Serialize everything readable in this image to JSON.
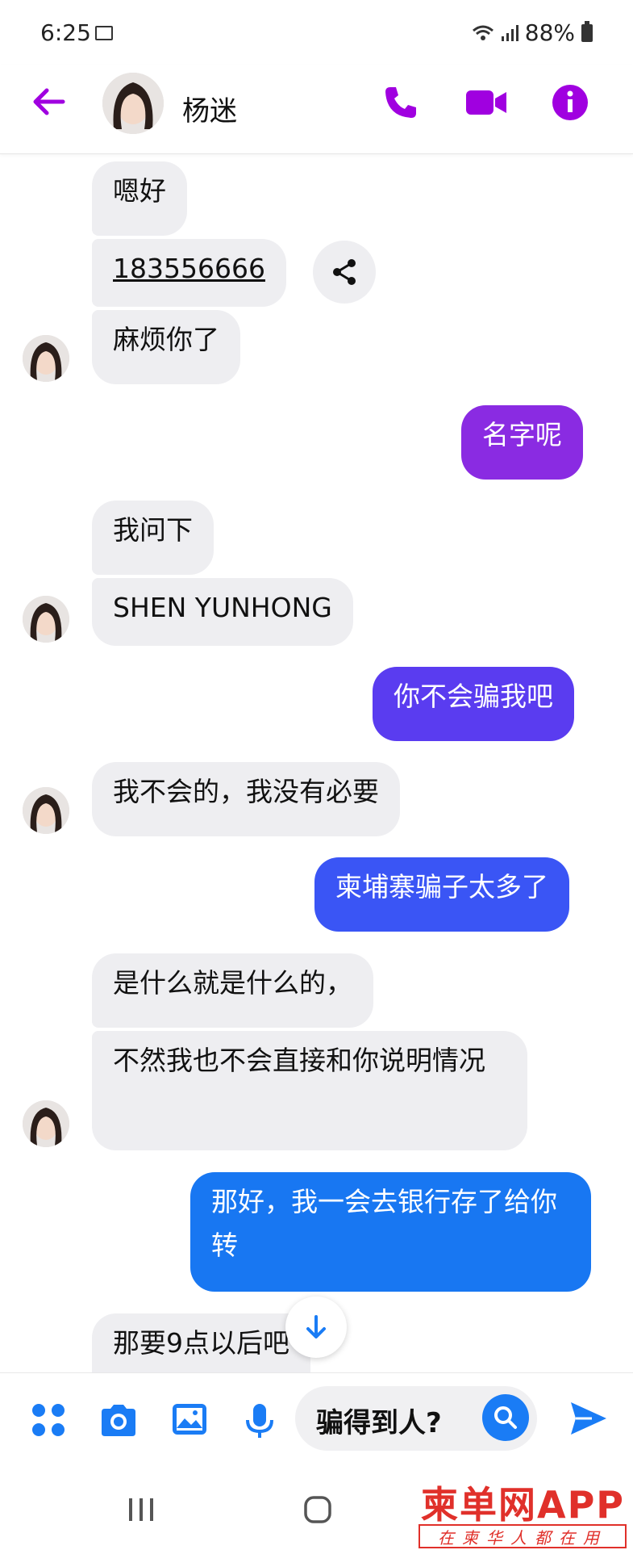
{
  "status_bar": {
    "time": "6:25",
    "battery": "88%"
  },
  "header": {
    "contact_name": "杨迷"
  },
  "messages": [
    {
      "text": "嗯好"
    },
    {
      "text": "183556666"
    },
    {
      "text": "麻烦你了"
    },
    {
      "text": "名字呢"
    },
    {
      "text": "我问下"
    },
    {
      "text": "SHEN YUNHONG"
    },
    {
      "text": "你不会骗我吧"
    },
    {
      "text": "我不会的，我没有必要"
    },
    {
      "text": "柬埔寨骗子太多了"
    },
    {
      "text": "是什么就是什么的，"
    },
    {
      "text": "不然我也不会直接和你说明情况"
    },
    {
      "text": "那好，我一会去银行存了给你转"
    },
    {
      "text": "那要9点以后吧"
    }
  ],
  "composer": {
    "input_value": "骗得到人?"
  },
  "watermark": {
    "logo": "柬单网APP",
    "tagline": "在柬华人都在用"
  },
  "colors": {
    "accent_purple": "#a000e0",
    "out_bubble_1": "#8a2be2",
    "out_bubble_2": "#5a3cf0",
    "out_bubble_3": "#3a55f5",
    "out_bubble_4": "#1877f2",
    "blue": "#1a7cf5"
  }
}
